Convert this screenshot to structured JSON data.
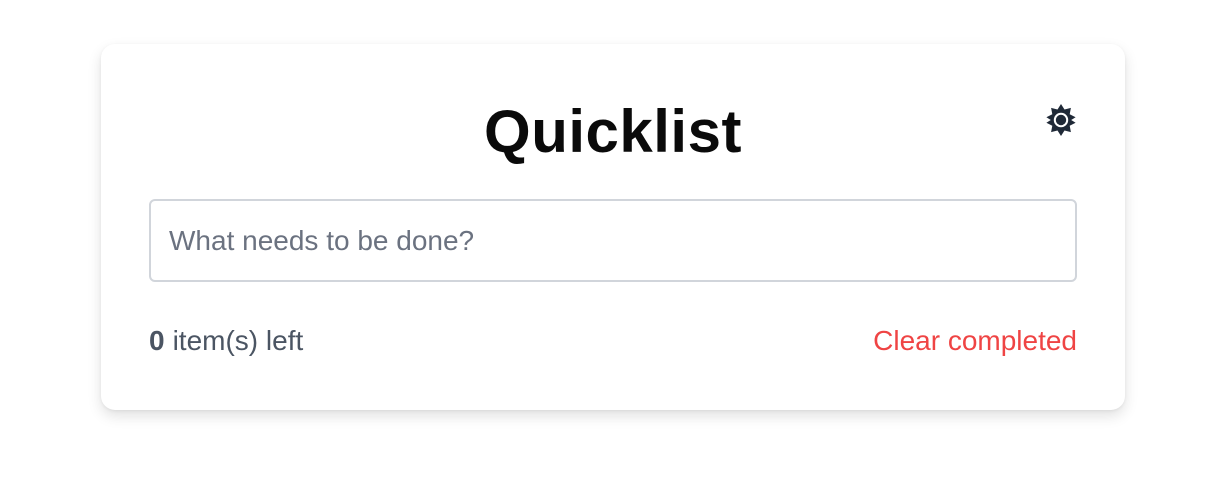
{
  "app": {
    "title": "Quicklist"
  },
  "header": {
    "theme_toggle_icon": "sun-icon"
  },
  "input": {
    "placeholder": "What needs to be done?",
    "value": ""
  },
  "footer": {
    "count": "0",
    "count_suffix": "item(s) left",
    "clear_label": "Clear completed"
  },
  "colors": {
    "accent_danger": "#ef4444",
    "text_muted": "#4b5563",
    "title": "#0a0a0a",
    "icon": "#1f2937"
  }
}
